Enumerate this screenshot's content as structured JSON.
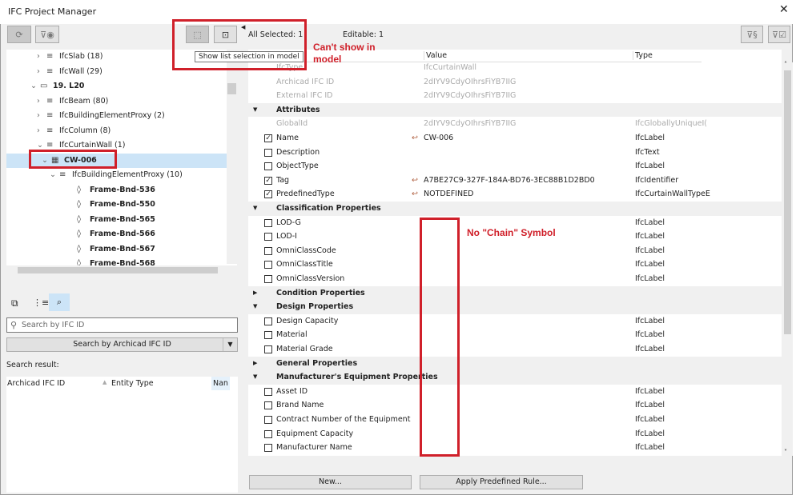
{
  "window": {
    "title": "IFC Project Manager",
    "close": "✕"
  },
  "toolbar": {
    "all_selected": "All Selected: 1",
    "editable": "Editable: 1",
    "tooltip": "Show list selection in model"
  },
  "tree": [
    {
      "label": "IfcSlab (18)",
      "indent": 1,
      "chev": "›",
      "icon": "≡",
      "bold": false
    },
    {
      "label": "IfcWall (29)",
      "indent": 1,
      "chev": "›",
      "icon": "≡",
      "bold": false
    },
    {
      "label": "19. L20",
      "indent": 0,
      "chev": "⌄",
      "icon": "▭",
      "bold": true
    },
    {
      "label": "IfcBeam (80)",
      "indent": 1,
      "chev": "›",
      "icon": "≡",
      "bold": false
    },
    {
      "label": "IfcBuildingElementProxy (2)",
      "indent": 1,
      "chev": "›",
      "icon": "≡",
      "bold": false
    },
    {
      "label": "IfcColumn (8)",
      "indent": 1,
      "chev": "›",
      "icon": "≡",
      "bold": false
    },
    {
      "label": "IfcCurtainWall (1)",
      "indent": 1,
      "chev": "⌄",
      "icon": "≡",
      "bold": false
    },
    {
      "label": "CW-006",
      "indent": 2,
      "chev": "⌄",
      "icon": "▦",
      "bold": true,
      "selected": true
    },
    {
      "label": "IfcBuildingElementProxy (10)",
      "indent": 3,
      "chev": "⌄",
      "icon": "≡",
      "bold": false
    },
    {
      "label": "Frame-Bnd-536",
      "indent": 4,
      "chev": "",
      "icon": "◊",
      "bold": true
    },
    {
      "label": "Frame-Bnd-550",
      "indent": 4,
      "chev": "",
      "icon": "◊",
      "bold": true
    },
    {
      "label": "Frame-Bnd-565",
      "indent": 4,
      "chev": "",
      "icon": "◊",
      "bold": true
    },
    {
      "label": "Frame-Bnd-566",
      "indent": 4,
      "chev": "",
      "icon": "◊",
      "bold": true
    },
    {
      "label": "Frame-Bnd-567",
      "indent": 4,
      "chev": "",
      "icon": "◊",
      "bold": true
    },
    {
      "label": "Frame-Bnd-568",
      "indent": 4,
      "chev": "",
      "icon": "◊",
      "bold": true
    }
  ],
  "search": {
    "placeholder": "Search by IFC ID",
    "button": "Search by Archicad IFC ID",
    "result_label": "Search result:",
    "columns": [
      "Archicad IFC ID",
      "Entity Type",
      "Nan"
    ]
  },
  "properties": {
    "columns": [
      "Value",
      "Type"
    ],
    "rows": [
      {
        "kind": "info",
        "name": "IfcType",
        "value": "IfcCurtainWall",
        "type": ""
      },
      {
        "kind": "info",
        "name": "Archicad IFC ID",
        "value": "2dIYV9CdyOIhrsFiYB7IIG",
        "type": ""
      },
      {
        "kind": "info",
        "name": "External IFC ID",
        "value": "2dIYV9CdyOIhrsFiYB7IIG",
        "type": ""
      },
      {
        "kind": "group",
        "name": "Attributes",
        "open": true
      },
      {
        "kind": "info",
        "name": "GlobalId",
        "value": "2dIYV9CdyOIhrsFiYB7IIG",
        "type": "IfcGloballyUniqueI("
      },
      {
        "kind": "prop",
        "name": "Name",
        "checked": true,
        "chain": true,
        "value": "CW-006",
        "type": "IfcLabel"
      },
      {
        "kind": "prop",
        "name": "Description",
        "checked": false,
        "value": "",
        "type": "IfcText"
      },
      {
        "kind": "prop",
        "name": "ObjectType",
        "checked": false,
        "value": "",
        "type": "IfcLabel"
      },
      {
        "kind": "prop",
        "name": "Tag",
        "checked": true,
        "chain": true,
        "value": "A7BE27C9-327F-184A-BD76-3EC88B1D2BD0",
        "type": "IfcIdentifier"
      },
      {
        "kind": "prop",
        "name": "PredefinedType",
        "checked": true,
        "chain": true,
        "value": "NOTDEFINED",
        "type": "IfcCurtainWallTypeE"
      },
      {
        "kind": "group",
        "name": "Classification Properties",
        "open": true
      },
      {
        "kind": "prop",
        "name": "LOD-G",
        "checked": false,
        "value": "",
        "type": "IfcLabel"
      },
      {
        "kind": "prop",
        "name": "LOD-I",
        "checked": false,
        "value": "",
        "type": "IfcLabel"
      },
      {
        "kind": "prop",
        "name": "OmniClassCode",
        "checked": false,
        "value": "",
        "type": "IfcLabel"
      },
      {
        "kind": "prop",
        "name": "OmniClassTitle",
        "checked": false,
        "value": "",
        "type": "IfcLabel"
      },
      {
        "kind": "prop",
        "name": "OmniClassVersion",
        "checked": false,
        "value": "",
        "type": "IfcLabel"
      },
      {
        "kind": "group",
        "name": "Condition Properties",
        "open": false
      },
      {
        "kind": "group",
        "name": "Design Properties",
        "open": true
      },
      {
        "kind": "prop",
        "name": "Design Capacity",
        "checked": false,
        "value": "",
        "type": "IfcLabel"
      },
      {
        "kind": "prop",
        "name": "Material",
        "checked": false,
        "value": "",
        "type": "IfcLabel"
      },
      {
        "kind": "prop",
        "name": "Material Grade",
        "checked": false,
        "value": "",
        "type": "IfcLabel"
      },
      {
        "kind": "group",
        "name": "General Properties",
        "open": false
      },
      {
        "kind": "group",
        "name": "Manufacturer's Equipment Properties",
        "open": true
      },
      {
        "kind": "prop",
        "name": "Asset ID",
        "checked": false,
        "value": "",
        "type": "IfcLabel"
      },
      {
        "kind": "prop",
        "name": "Brand Name",
        "checked": false,
        "value": "",
        "type": "IfcLabel"
      },
      {
        "kind": "prop",
        "name": "Contract Number of the Equipment",
        "checked": false,
        "value": "",
        "type": "IfcLabel"
      },
      {
        "kind": "prop",
        "name": "Equipment Capacity",
        "checked": false,
        "value": "",
        "type": "IfcLabel"
      },
      {
        "kind": "prop",
        "name": "Manufacturer Name",
        "checked": false,
        "value": "",
        "type": "IfcLabel"
      }
    ]
  },
  "buttons": {
    "new": "New...",
    "apply": "Apply Predefined Rule..."
  },
  "annotations": {
    "cant_show": "Can't show in model",
    "no_chain": "No \"Chain\" Symbol",
    "color": "#d0202a"
  }
}
